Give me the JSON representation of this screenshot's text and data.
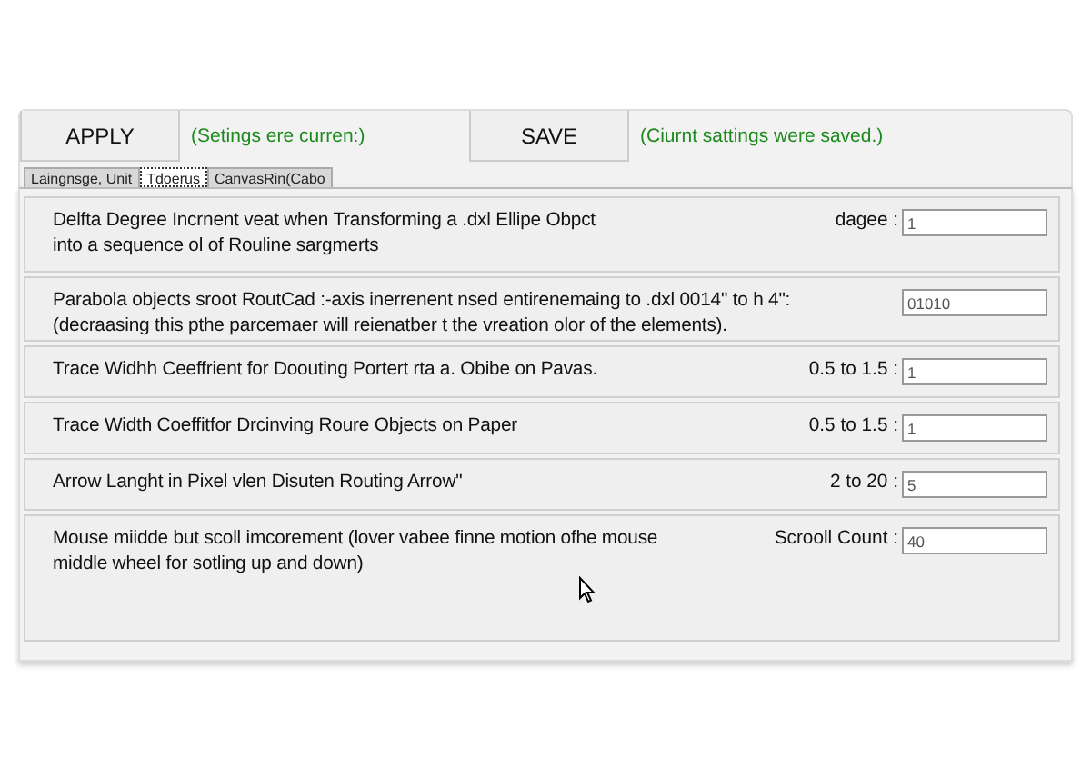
{
  "toolbar": [
    {
      "button": "APPLY",
      "status": "(Setings ere curren:)"
    },
    {
      "button": "SAVE",
      "status": "(Ciurnt sattings were saved.)"
    }
  ],
  "tabs": [
    {
      "label": "Laingnsge, Unit",
      "selected": false
    },
    {
      "label": "Tdoerus",
      "selected": true
    },
    {
      "label": "CanvasRin(Cabo",
      "selected": false
    }
  ],
  "settings": [
    {
      "description": "Delfta Degree Incrnent veat when Transforming a .dxl Ellipe Obpct\ninto a sequence ol of Rouline sargmerts",
      "range": "dagee :",
      "value": "1"
    },
    {
      "description": "Parabola objects sroot RoutCad :-axis inerrenent nsed entirenemaing to .dxl  0014\" to h 4\":\n(decraasing this pthe parcemaer will reienatber t the vreation olor of the elements).",
      "value": "01010"
    },
    {
      "description": "Trace Widhh Ceeffrient for Doouting Portert rta a. Obibe on Pavas.",
      "range": "0.5 to 1.5 :",
      "value": "1"
    },
    {
      "description": "Trace Width Coeffitfor Drcinving Roure Objects on Paper",
      "range": "0.5 to 1.5 :",
      "value": "1"
    },
    {
      "description": "Arrow Langht in Pixel vlen Disuten Routing Arrow\"",
      "range": "2 to 20 :",
      "value": "5"
    },
    {
      "description": "Mouse miidde but scoll imcorement (lover vabee finne motion ofhe mouse\nmiddle wheel for sotling up and down)",
      "range": "Scrooll Count :",
      "value": "40"
    }
  ]
}
